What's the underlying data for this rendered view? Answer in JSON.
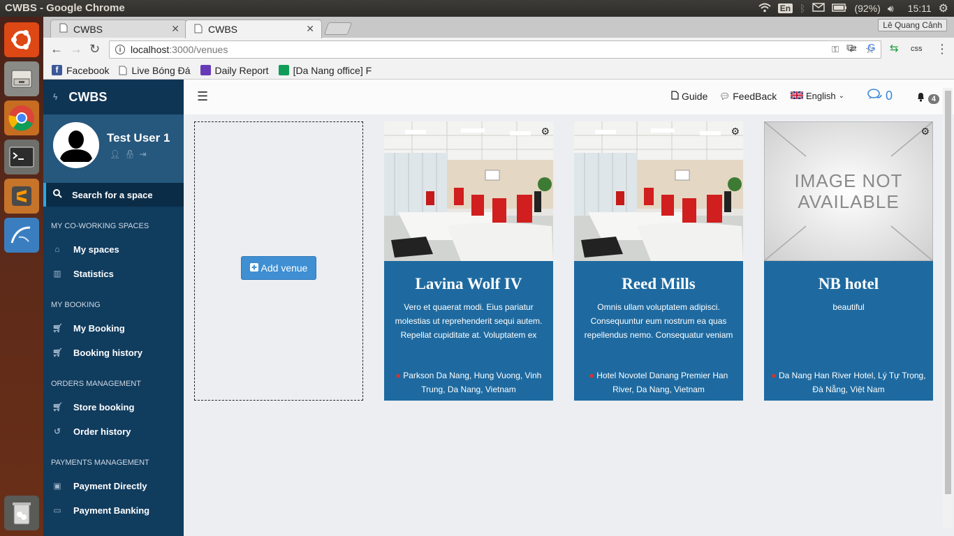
{
  "os": {
    "window_title": "CWBS - Google Chrome",
    "keyboard": "En",
    "battery": "(92%)",
    "clock": "15:11"
  },
  "browser": {
    "tabs": [
      {
        "label": "CWBS"
      },
      {
        "label": "CWBS"
      }
    ],
    "profile": "Lê Quang Cảnh",
    "url_host": "localhost",
    "url_path": ":3000/venues",
    "bookmarks": [
      {
        "label": "Facebook",
        "color": "#3b5998"
      },
      {
        "label": "Live Bóng Đá",
        "color": "#ffffff"
      },
      {
        "label": "Daily Report",
        "color": "#673ab7"
      },
      {
        "label": "[Da Nang office] F",
        "color": "#0f9d58"
      }
    ]
  },
  "sidebar": {
    "brand": "CWBS",
    "user_name": "Test User 1",
    "search_label": "Search for a space",
    "sections": [
      {
        "title": "MY CO-WORKING SPACES",
        "items": [
          "My spaces",
          "Statistics"
        ]
      },
      {
        "title": "MY BOOKING",
        "items": [
          "My Booking",
          "Booking history"
        ]
      },
      {
        "title": "ORDERS MANAGEMENT",
        "items": [
          "Store booking",
          "Order history"
        ]
      },
      {
        "title": "PAYMENTS MANAGEMENT",
        "items": [
          "Payment Directly",
          "Payment Banking"
        ]
      }
    ]
  },
  "header": {
    "guide": "Guide",
    "feedback": "FeedBack",
    "language": "English",
    "messages_count": "0",
    "notifications_count": "4"
  },
  "main": {
    "add_venue_label": "Add venue",
    "venues": [
      {
        "name": "Lavina Wolf IV",
        "description": "Vero et quaerat modi. Eius pariatur molestias ut reprehenderit sequi autem. Repellat cupiditate at. Voluptatem ex",
        "address": "Parkson Da Nang, Hung Vuong, Vinh Trung, Da Nang, Vietnam",
        "image": "office-photo"
      },
      {
        "name": "Reed Mills",
        "description": "Omnis ullam voluptatem adipisci. Consequuntur eum nostrum ea quas repellendus nemo. Consequatur veniam",
        "address": "Hotel Novotel Danang Premier Han River, Da Nang, Vietnam",
        "image": "office-photo"
      },
      {
        "name": "NB hotel",
        "description": "beautiful",
        "address": "Da Nang Han River Hotel, Lý Tự Trọng, Đà Nẵng, Việt Nam",
        "image": "image-not-available",
        "placeholder_text_1": "IMAGE NOT",
        "placeholder_text_2": "AVAILABLE"
      }
    ]
  }
}
